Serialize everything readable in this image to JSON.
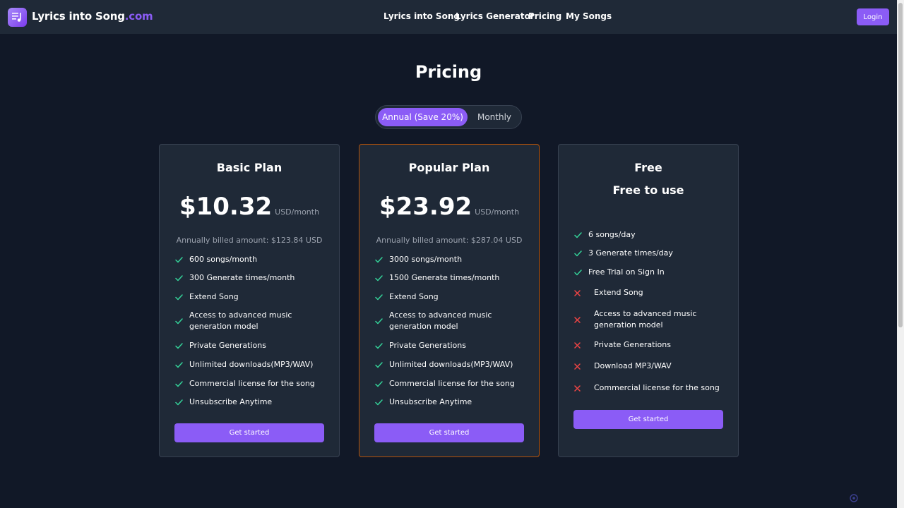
{
  "header": {
    "brand": "Lyrics into Song",
    "brand_suffix": ".com",
    "nav": [
      "Lyrics into Song",
      "Lyrics Generator",
      "Pricing",
      "My Songs"
    ],
    "login": "Login"
  },
  "page": {
    "title": "Pricing",
    "toggle": {
      "annual": "Annual (Save 20%)",
      "monthly": "Monthly",
      "selected": "annual"
    }
  },
  "plans": [
    {
      "name": "Basic Plan",
      "price": "$10.32",
      "unit": "USD/month",
      "billed": "Annually billed amount: $123.84 USD",
      "features": [
        {
          "text": "600 songs/month",
          "included": true
        },
        {
          "text": "300 Generate times/month",
          "included": true
        },
        {
          "text": "Extend Song",
          "included": true
        },
        {
          "text": "Access to advanced music generation model",
          "included": true
        },
        {
          "text": "Private Generations",
          "included": true
        },
        {
          "text": "Unlimited downloads(MP3/WAV)",
          "included": true
        },
        {
          "text": "Commercial license for the song",
          "included": true
        },
        {
          "text": "Unsubscribe Anytime",
          "included": true
        }
      ],
      "button": "Get started"
    },
    {
      "name": "Popular Plan",
      "price": "$23.92",
      "unit": "USD/month",
      "billed": "Annually billed amount: $287.04 USD",
      "features": [
        {
          "text": "3000 songs/month",
          "included": true
        },
        {
          "text": "1500 Generate times/month",
          "included": true
        },
        {
          "text": "Extend Song",
          "included": true
        },
        {
          "text": "Access to advanced music generation model",
          "included": true
        },
        {
          "text": "Private Generations",
          "included": true
        },
        {
          "text": "Unlimited downloads(MP3/WAV)",
          "included": true
        },
        {
          "text": "Commercial license for the song",
          "included": true
        },
        {
          "text": "Unsubscribe Anytime",
          "included": true
        }
      ],
      "button": "Get started"
    },
    {
      "name": "Free",
      "subtitle": "Free to use",
      "features": [
        {
          "text": "6 songs/day",
          "included": true
        },
        {
          "text": "3 Generate times/day",
          "included": true
        },
        {
          "text": "Free Trial on Sign In",
          "included": true
        },
        {
          "text": "Extend Song",
          "included": false
        },
        {
          "text": "Access to advanced music generation model",
          "included": false
        },
        {
          "text": "Private Generations",
          "included": false
        },
        {
          "text": "Download MP3/WAV",
          "included": false
        },
        {
          "text": "Commercial license for the song",
          "included": false
        }
      ],
      "button": "Get started"
    }
  ],
  "colors": {
    "accent": "#8b5cf6",
    "check": "#34d399",
    "cross": "#ef4444",
    "popular_border": "#b45309",
    "background": "#111827",
    "card": "#1f2937"
  },
  "icons": {
    "logo": "music-note-list-icon",
    "included": "check-icon",
    "excluded": "x-icon"
  }
}
